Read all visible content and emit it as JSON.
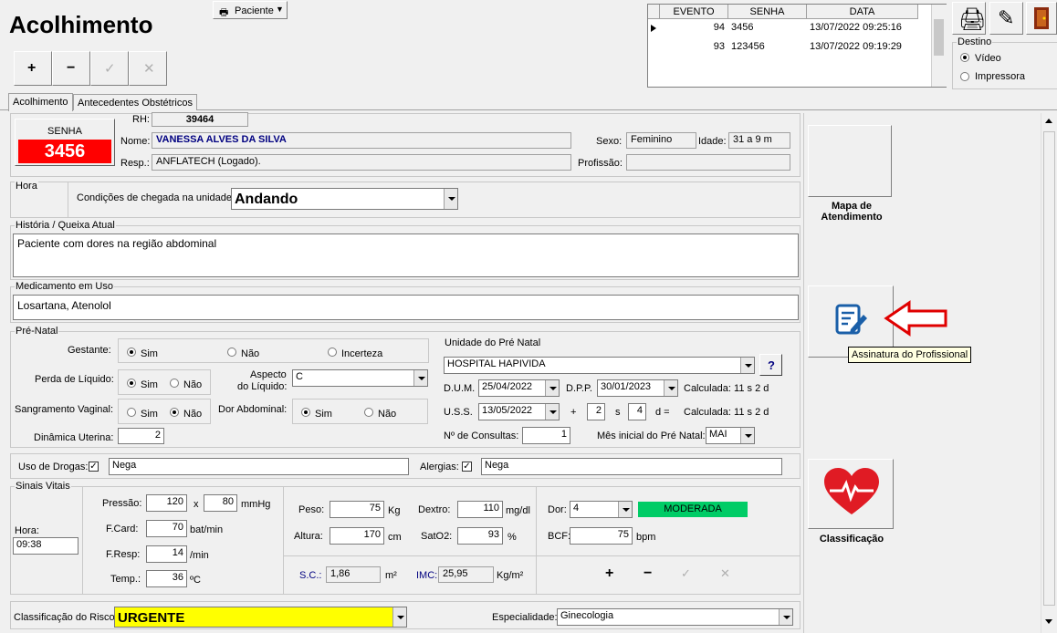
{
  "window": {
    "title": "Acolhimento",
    "paciente_menu": "Paciente"
  },
  "toolbar_top": {
    "add": "+",
    "remove": "−",
    "confirm": "✓",
    "cancel": "✕"
  },
  "event_table": {
    "headers": [
      "EVENTO",
      "SENHA",
      "DATA"
    ],
    "rows": [
      [
        "94",
        "3456",
        "13/07/2022 09:25:16"
      ],
      [
        "93",
        "123456",
        "13/07/2022 09:19:29"
      ]
    ]
  },
  "destino": {
    "title": "Destino",
    "options": [
      "Vídeo",
      "Impressora"
    ],
    "selected": "Vídeo"
  },
  "tabs": [
    "Acolhimento",
    "Antecedentes Obstétricos"
  ],
  "senha": {
    "label": "SENHA",
    "value": "3456"
  },
  "patient": {
    "rh_label": "RH:",
    "rh": "39464",
    "nome_label": "Nome:",
    "nome": "VANESSA  ALVES DA SILVA",
    "resp_label": "Resp.:",
    "resp": "ANFLATECH (Logado).",
    "sexo_label": "Sexo:",
    "sexo": "Feminino",
    "idade_label": "Idade:",
    "idade": "31 a 9 m",
    "profissao_label": "Profissão:",
    "profissao": ""
  },
  "chegada": {
    "hora_label": "Hora",
    "label": "Condições de chegada na unidade:",
    "value": "Andando"
  },
  "historia": {
    "label": "História / Queixa Atual",
    "value": "Paciente com dores na região abdominal"
  },
  "medicamento": {
    "label": "Medicamento em Uso",
    "value": "Losartana, Atenolol"
  },
  "pre_natal": {
    "label": "Pré-Natal",
    "gestante_label": "Gestante:",
    "gestante_options": [
      "Sim",
      "Não",
      "Incerteza"
    ],
    "gestante": "Sim",
    "perda_label": "Perda de Líquido:",
    "perda_options": [
      "Sim",
      "Não"
    ],
    "perda": "Sim",
    "aspecto_label1": "Aspecto",
    "aspecto_label2": "do Líquido:",
    "aspecto": "C",
    "sangramento_label": "Sangramento Vaginal:",
    "sangramento_options": [
      "Sim",
      "Não"
    ],
    "sangramento": "Não",
    "dor_label": "Dor Abdominal:",
    "dor_options": [
      "Sim",
      "Não"
    ],
    "dor": "Sim",
    "dinamica_label": "Dinâmica Uterina:",
    "dinamica": "2",
    "unidade_label": "Unidade do Pré Natal",
    "unidade": "HOSPITAL HAPIVIDA",
    "help": "?",
    "dum_label": "D.U.M.",
    "dum": "25/04/2022",
    "dpp_label": "D.P.P.",
    "dpp": "30/01/2023",
    "calc1": "Calculada: 11 s 2 d",
    "uss_label": "U.S.S.",
    "uss": "13/05/2022",
    "plus": "+",
    "semanas": "2",
    "s_label": "s",
    "dias": "4",
    "d_label": "d =",
    "calc2": "Calculada: 11 s 2 d",
    "consultas_label": "Nº de Consultas:",
    "consultas": "1",
    "mes_label": "Mês inicial do Pré Natal:",
    "mes": "MAI"
  },
  "drogas": {
    "label": "Uso de Drogas:",
    "value": "Nega",
    "checked": "✓"
  },
  "alergias": {
    "label": "Alergias:",
    "value": "Nega",
    "checked": "✓"
  },
  "sinais": {
    "label": "Sinais Vitais",
    "hora_label": "Hora:",
    "hora": "09:38",
    "pressao_label": "Pressão:",
    "pa_sis": "120",
    "pa_x": "x",
    "pa_dia": "80",
    "pa_unit": "mmHg",
    "fcard_label": "F.Card:",
    "fcard": "70",
    "fcard_unit": "bat/min",
    "fresp_label": "F.Resp:",
    "fresp": "14",
    "fresp_unit": "/min",
    "temp_label": "Temp.:",
    "temp": "36",
    "temp_unit": "ºC",
    "peso_label": "Peso:",
    "peso": "75",
    "peso_unit": "Kg",
    "altura_label": "Altura:",
    "altura": "170",
    "altura_unit": "cm",
    "dextro_label": "Dextro:",
    "dextro": "110",
    "dextro_unit": "mg/dl",
    "sato2_label": "SatO2:",
    "sato2": "93",
    "sato2_unit": "%",
    "dor_label": "Dor:",
    "dor": "4",
    "dor_level": "MODERADA",
    "bcf_label": "BCF:",
    "bcf": "75",
    "bcf_unit": "bpm",
    "sc_label": "S.C.:",
    "sc": "1,86",
    "sc_unit": "m²",
    "imc_label": "IMC:",
    "imc": "25,95",
    "imc_unit": "Kg/m²"
  },
  "bottom_toolbar": {
    "add": "+",
    "remove": "−",
    "confirm": "✓",
    "cancel": "✕"
  },
  "risco": {
    "label": "Classificação do Risco:",
    "value": "URGENTE"
  },
  "especialidade": {
    "label": "Especialidade:",
    "value": "Ginecologia"
  },
  "side": {
    "mapa": "Mapa de Atendimento",
    "assinatura_tooltip": "Assinatura do Profissional",
    "classificacao": "Classificação"
  },
  "colors": {
    "senha_bg": "#ff0000",
    "moderada": "#00cc66",
    "urgente": "#ffff00",
    "nome": "#000080",
    "arrow": "#e00000"
  }
}
